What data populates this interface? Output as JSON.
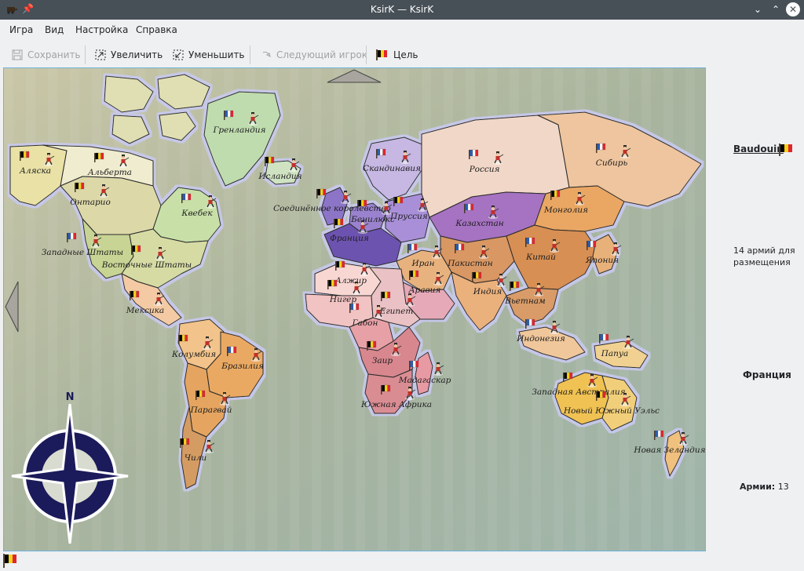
{
  "window": {
    "title": "KsirK — KsirK",
    "minimize_label": "⌄",
    "maximize_label": "⌃",
    "close_label": "✕"
  },
  "menu": {
    "items": [
      "Игра",
      "Вид",
      "Настройка",
      "Справка"
    ]
  },
  "toolbar": {
    "save_label": "Сохранить",
    "zoom_in_label": "Увеличить",
    "zoom_out_label": "Уменьшить",
    "next_player_label": "Следующий игрок",
    "goal_label": "Цель"
  },
  "map": {
    "territories": [
      {
        "name": "Аляска",
        "color": "#e9e1a6",
        "owner": "belgium"
      },
      {
        "name": "Альберта",
        "color": "#f0eccf",
        "owner": "belgium"
      },
      {
        "name": "Гренландия",
        "color": "#bfdcae",
        "owner": "france"
      },
      {
        "name": "Исландия",
        "color": "#cfe3c2",
        "owner": "belgium"
      },
      {
        "name": "Онтарио",
        "color": "#dcd8a8",
        "owner": "belgium"
      },
      {
        "name": "Квебек",
        "color": "#c8e0a8",
        "owner": "france"
      },
      {
        "name": "Западные Штаты",
        "color": "#c7d494",
        "owner": "france"
      },
      {
        "name": "Восточные Штаты",
        "color": "#d6dba4",
        "owner": "belgium"
      },
      {
        "name": "Мексика",
        "color": "#f3caa3",
        "owner": "belgium"
      },
      {
        "name": "Колумбия",
        "color": "#f2c38a",
        "owner": "belgium"
      },
      {
        "name": "Бразилия",
        "color": "#eaa963",
        "owner": "france"
      },
      {
        "name": "Парагвай",
        "color": "#e5a561",
        "owner": "belgium"
      },
      {
        "name": "Чили",
        "color": "#d49c63",
        "owner": "belgium"
      },
      {
        "name": "Скандинавия",
        "color": "#c6b7e3",
        "owner": "france"
      },
      {
        "name": "Соединённое королевство",
        "color": "#8c74c6",
        "owner": "belgium"
      },
      {
        "name": "Бенилюкс",
        "color": "#9a82cf",
        "owner": "belgium"
      },
      {
        "name": "Пруссия",
        "color": "#a98fd8",
        "owner": "belgium"
      },
      {
        "name": "Франция",
        "color": "#6d52b0",
        "owner": "belgium"
      },
      {
        "name": "Россия",
        "color": "#f1d7c7",
        "owner": "france"
      },
      {
        "name": "Сибирь",
        "color": "#eec59e",
        "owner": "france"
      },
      {
        "name": "Казахстан",
        "color": "#a672c2",
        "owner": "france"
      },
      {
        "name": "Монголия",
        "color": "#e9a763",
        "owner": "belgium"
      },
      {
        "name": "Пакистан",
        "color": "#d89763",
        "owner": "france"
      },
      {
        "name": "Китай",
        "color": "#d88f53",
        "owner": "france"
      },
      {
        "name": "Япония",
        "color": "#e8b17a",
        "owner": "france"
      },
      {
        "name": "Иран",
        "color": "#e8b27e",
        "owner": "france"
      },
      {
        "name": "Аравия",
        "color": "#e5a9b7",
        "owner": "belgium"
      },
      {
        "name": "Индия",
        "color": "#ebb17c",
        "owner": "belgium"
      },
      {
        "name": "Вьетнам",
        "color": "#d99b67",
        "owner": "belgium"
      },
      {
        "name": "Алжир",
        "color": "#f8d7d3",
        "owner": "belgium"
      },
      {
        "name": "Нигер",
        "color": "#f1c3c2",
        "owner": "belgium"
      },
      {
        "name": "Египет",
        "color": "#eac1c4",
        "owner": "belgium"
      },
      {
        "name": "Габон",
        "color": "#e7a0a6",
        "owner": "france"
      },
      {
        "name": "Заир",
        "color": "#d8878f",
        "owner": "belgium"
      },
      {
        "name": "Мадагаскар",
        "color": "#e79aa3",
        "owner": "france"
      },
      {
        "name": "Южная Африка",
        "color": "#d98d93",
        "owner": "belgium"
      },
      {
        "name": "Индонезия",
        "color": "#f0c79b",
        "owner": "france"
      },
      {
        "name": "Папуа",
        "color": "#f1d191",
        "owner": "france"
      },
      {
        "name": "Западная Австралия",
        "color": "#f0c252",
        "owner": "belgium"
      },
      {
        "name": "Новый Южный Уэльс",
        "color": "#f1cf7a",
        "owner": "belgium"
      },
      {
        "name": "Новая Зеландия",
        "color": "#efc07e",
        "owner": "france"
      }
    ],
    "compass_label": "N"
  },
  "sidebar": {
    "player_name": "Baudouin",
    "armies_to_place": "14 армий для размещения",
    "country": "Франция",
    "armies_label": "Армии:",
    "armies_count": "13"
  },
  "colors": {
    "belgium_flag": [
      "#000000",
      "#f5d218",
      "#e0252f"
    ],
    "france_flag": [
      "#2a5db5",
      "#ffffff",
      "#e0252f"
    ],
    "sea": "#a9b39b",
    "compass": "#1b1a5a"
  }
}
